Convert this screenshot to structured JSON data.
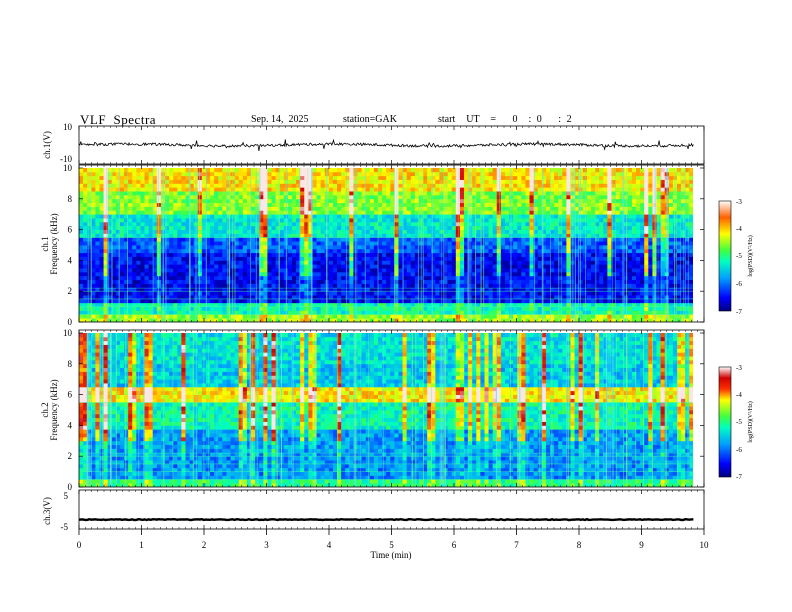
{
  "header": {
    "title": "VLF  Spectra",
    "date": "Sep. 14,  2025",
    "station": "station=GAK",
    "start_ut": "start  UT  =   0  : 0   : 2"
  },
  "chart_data": [
    {
      "type": "line",
      "panel": "ch1-waveform",
      "ylabel": "ch.1(V)",
      "ylim": [
        -10,
        10
      ],
      "yticks": [
        "10",
        "-10"
      ],
      "x_range_min": [
        0,
        9.83
      ],
      "description_values": {
        "baseline_v": 0
      }
    },
    {
      "type": "heatmap",
      "panel": "ch1-spectrogram",
      "ylabel": "ch.1\nFrequency  (kHz)",
      "ylabel_lines": [
        "ch.1",
        "Frequency  (kHz)"
      ],
      "ylim": [
        0,
        10
      ],
      "yticks": [
        "0",
        "2",
        "4",
        "6",
        "8",
        "10"
      ],
      "colorbar": {
        "label": "log(PSD)(V²/Hz)",
        "range": [
          -7,
          -3
        ],
        "ticks": [
          "-3",
          "-4",
          "-5",
          "-6",
          "-7"
        ]
      }
    },
    {
      "type": "heatmap",
      "panel": "ch2-spectrogram",
      "ylabel_lines": [
        "ch.2",
        "Frequency  (kHz)"
      ],
      "ylim": [
        0,
        10
      ],
      "yticks": [
        "0",
        "2",
        "4",
        "6",
        "8",
        "10"
      ],
      "colorbar": {
        "label": "log(PSD)(V²/Hz)",
        "range": [
          -7,
          -3
        ],
        "ticks": [
          "-3",
          "-4",
          "-5",
          "-6",
          "-7"
        ]
      }
    },
    {
      "type": "line",
      "panel": "ch3-waveform",
      "ylabel": "ch.3(V)",
      "ylim": [
        -5,
        5
      ],
      "yticks": [
        "5",
        "-5"
      ],
      "x_range_min": [
        0,
        9.83
      ],
      "description_values": {
        "baseline_v": -3
      }
    }
  ],
  "xaxis": {
    "label": "Time  (min)",
    "ticks": [
      "0",
      "1",
      "2",
      "3",
      "4",
      "5",
      "6",
      "7",
      "8",
      "9",
      "10"
    ],
    "xlim": [
      0,
      10
    ]
  },
  "colorbar_label_html": "log(PSD)(V²/Hz)"
}
